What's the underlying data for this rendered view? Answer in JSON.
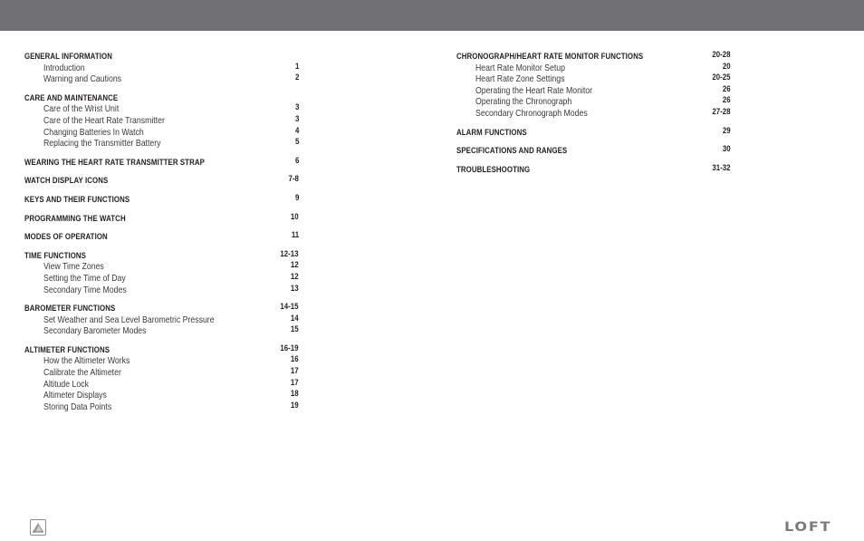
{
  "header": {
    "bar_color": "#717173"
  },
  "toc": {
    "left": [
      {
        "title": "GENERAL INFORMATION",
        "page": "",
        "items": [
          {
            "title": "Introduction",
            "page": "1"
          },
          {
            "title": "Warning and Cautions",
            "page": "2"
          }
        ]
      },
      {
        "title": "CARE AND MAINTENANCE",
        "page": "",
        "items": [
          {
            "title": "Care of the Wrist Unit",
            "page": "3"
          },
          {
            "title": "Care of the Heart Rate Transmitter",
            "page": "3"
          },
          {
            "title": "Changing Batteries In Watch",
            "page": "4"
          },
          {
            "title": "Replacing the Transmitter Battery",
            "page": "5"
          }
        ]
      },
      {
        "title": "WEARING THE HEART RATE TRANSMITTER STRAP",
        "page": "6",
        "items": []
      },
      {
        "title": "WATCH DISPLAY ICONS",
        "page": "7-8",
        "items": []
      },
      {
        "title": "KEYS AND THEIR FUNCTIONS",
        "page": "9",
        "items": []
      },
      {
        "title": "PROGRAMMING THE WATCH",
        "page": "10",
        "items": []
      },
      {
        "title": "MODES OF OPERATION",
        "page": "11",
        "items": []
      },
      {
        "title": "TIME FUNCTIONS",
        "page": "12-13",
        "items": [
          {
            "title": "View Time Zones",
            "page": "12"
          },
          {
            "title": "Setting the Time of Day",
            "page": "12"
          },
          {
            "title": "Secondary Time Modes",
            "page": "13"
          }
        ]
      },
      {
        "title": "BAROMETER FUNCTIONS",
        "page": "14-15",
        "items": [
          {
            "title": "Set Weather and Sea Level Barometric Pressure",
            "page": "14"
          },
          {
            "title": "Secondary Barometer Modes",
            "page": "15"
          }
        ]
      },
      {
        "title": "ALTIMETER FUNCTIONS",
        "page": "16-19",
        "items": [
          {
            "title": "How the Altimeter Works",
            "page": "16"
          },
          {
            "title": "Calibrate the Altimeter",
            "page": "17"
          },
          {
            "title": "Altitude Lock",
            "page": "17"
          },
          {
            "title": "Altimeter Displays",
            "page": "18"
          },
          {
            "title": "Storing Data Points",
            "page": "19"
          }
        ]
      }
    ],
    "right": [
      {
        "title": "CHRONOGRAPH/HEART RATE MONITOR FUNCTIONS",
        "page": "20-28",
        "items": [
          {
            "title": "Heart Rate Monitor Setup",
            "page": "20"
          },
          {
            "title": "Heart Rate Zone Settings",
            "page": "20-25"
          },
          {
            "title": "Operating the Heart Rate Monitor",
            "page": "26"
          },
          {
            "title": "Operating the Chronograph",
            "page": "26"
          },
          {
            "title": "Secondary Chronograph Modes",
            "page": "27-28"
          }
        ]
      },
      {
        "title": "ALARM FUNCTIONS",
        "page": "29",
        "items": []
      },
      {
        "title": "SPECIFICATIONS AND RANGES",
        "page": "30",
        "items": []
      },
      {
        "title": "TROUBLESHOOTING",
        "page": "31-32",
        "items": []
      }
    ]
  },
  "footer": {
    "icon": "mountain-logo-icon",
    "brand": "LOFT"
  }
}
